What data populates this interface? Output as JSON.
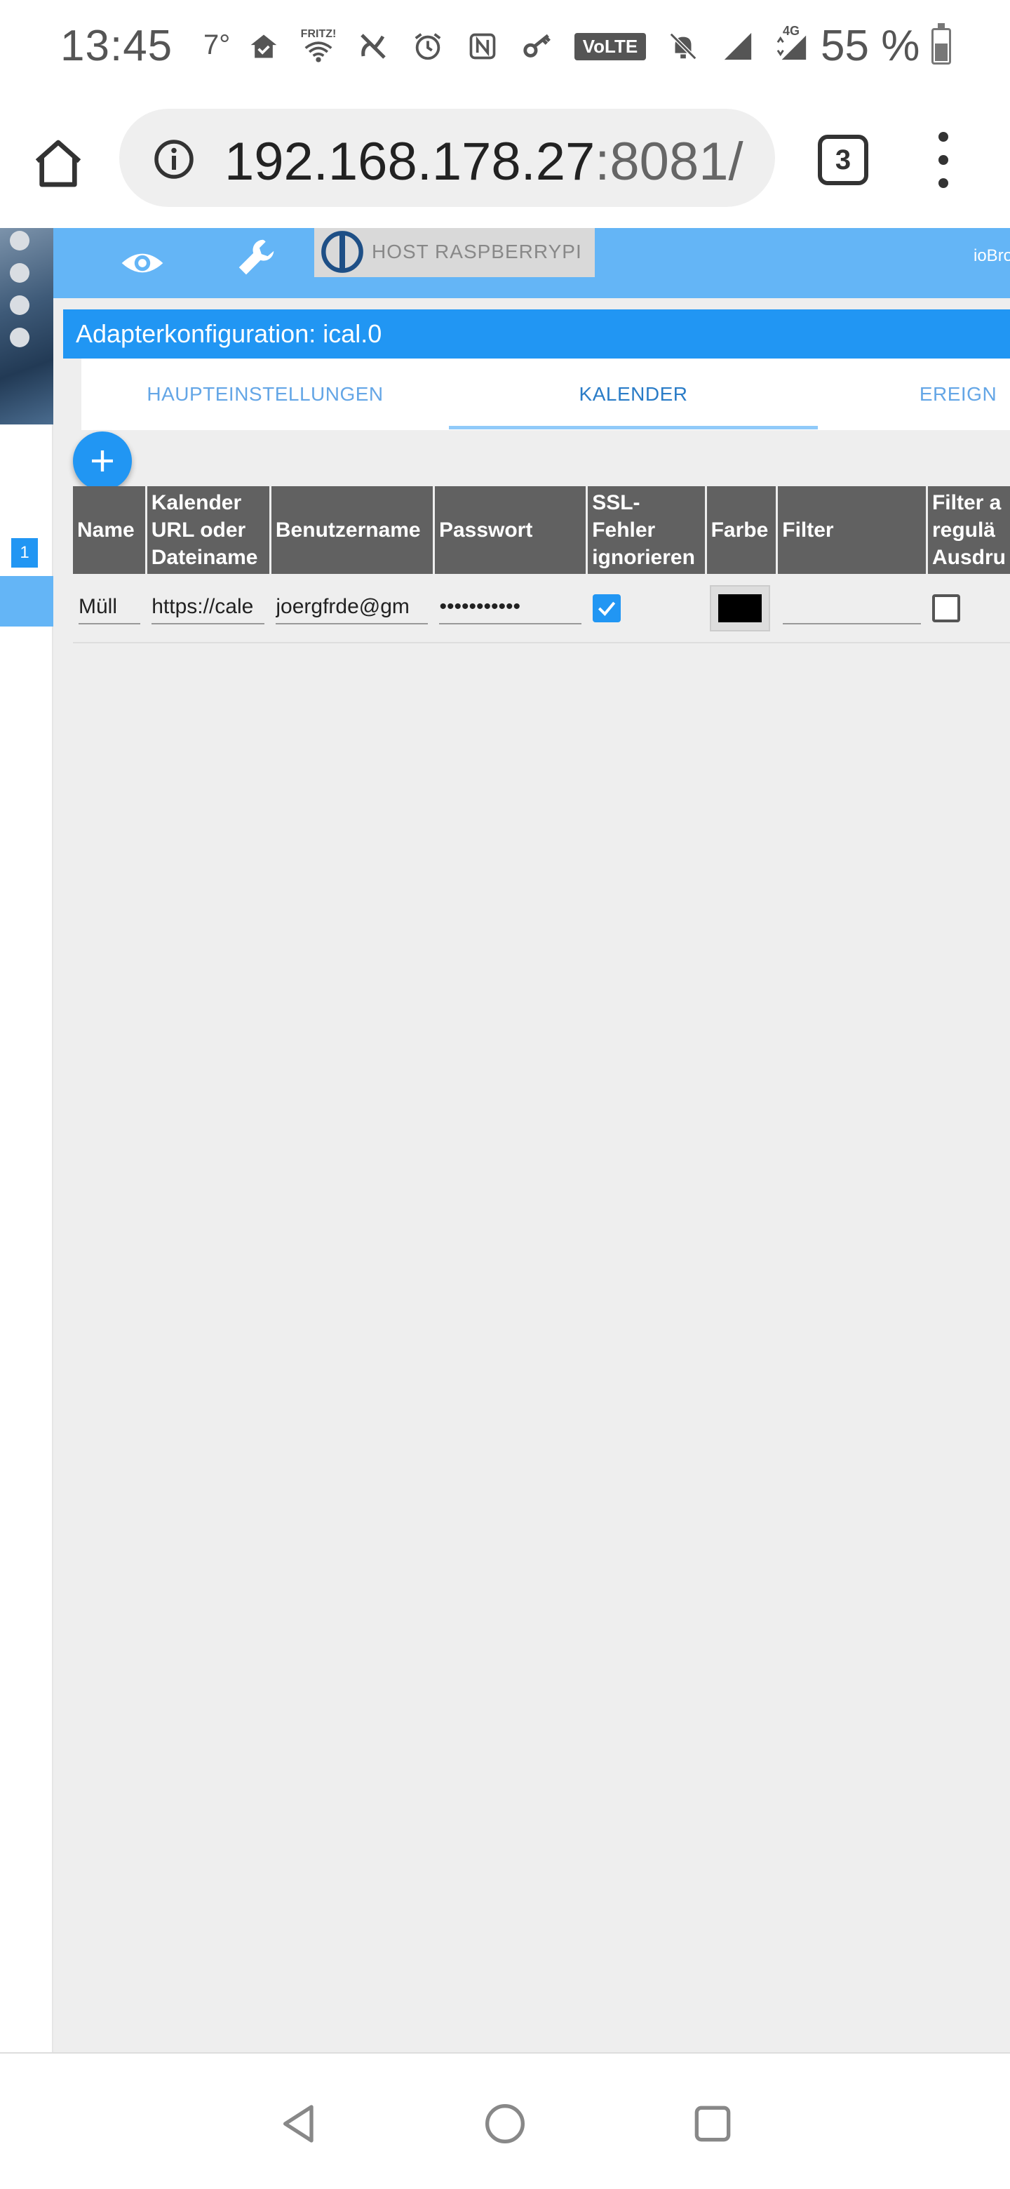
{
  "status_bar": {
    "time": "13:45",
    "temperature": "7°",
    "fritz_label": "FRITZ!",
    "volte_label": "VoLTE",
    "network_label": "4G",
    "battery_percent": "55 %",
    "battery_level": 0.55
  },
  "browser": {
    "url_host": "192.168.178.27",
    "url_port": ":8081/",
    "tab_count": "3"
  },
  "app": {
    "host_label": "HOST RASPBERRYPI",
    "top_right_label": "ioBro",
    "sidebar_badge": "1",
    "adapter_title": "Adapterkonfiguration: ical.0",
    "tabs": [
      {
        "label": "HAUPTEINSTELLUNGEN",
        "active": false
      },
      {
        "label": "KALENDER",
        "active": true
      },
      {
        "label": "EREIGN",
        "active": false
      }
    ],
    "add_label": "+"
  },
  "calendar_table": {
    "headers": {
      "name": "Name",
      "url_line1": "Kalender",
      "url_line2": "URL oder",
      "url_line3": "Dateiname",
      "user": "Benutzername",
      "password": "Passwort",
      "ssl_line1": "SSL-",
      "ssl_line2": "Fehler",
      "ssl_line3": "ignorieren",
      "color": "Farbe",
      "filter": "Filter",
      "regex_line1": "Filter a",
      "regex_line2": "regulä",
      "regex_line3": "Ausdru"
    },
    "rows": [
      {
        "name": "Müll",
        "url": "https://cale",
        "user": "joergfrde@gm",
        "password": "•••••••••••",
        "ssl_ignore": true,
        "color": "#000000",
        "filter": "",
        "filter_regex": false
      }
    ]
  },
  "colors": {
    "accent": "#2196f3",
    "top_bar": "#64b5f6",
    "table_header": "#616161",
    "content_bg": "#eeeeee"
  }
}
